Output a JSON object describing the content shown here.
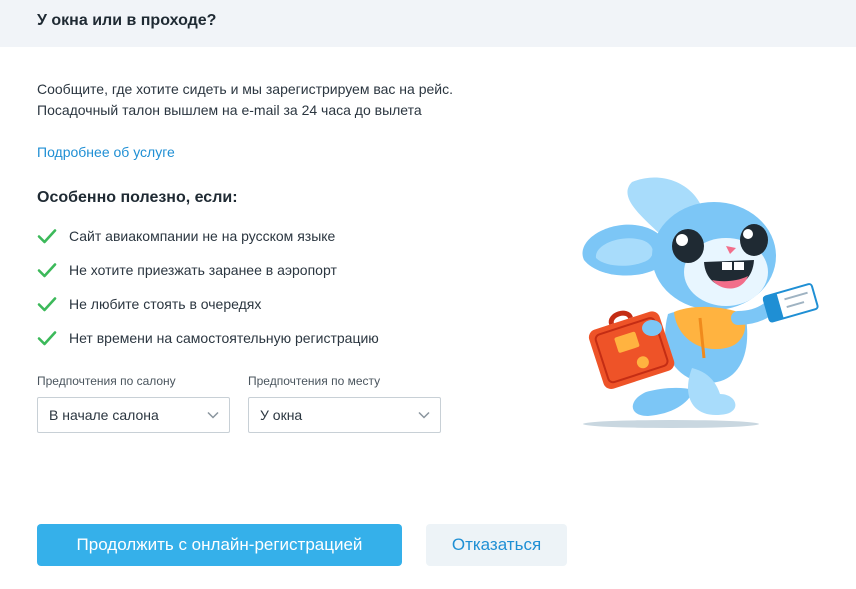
{
  "header": {
    "title": "У окна или в проходе?"
  },
  "description": {
    "line1": "Сообщите, где хотите сидеть и мы зарегистрируем вас на рейс.",
    "line2": "Посадочный талон вышлем на e-mail за 24 часа до вылета"
  },
  "more_link": "Подробнее об услуге",
  "benefits": {
    "title": "Особенно полезно, если:",
    "items": [
      "Сайт авиакомпании не на русском языке",
      "Не хотите приезжать заранее в аэропорт",
      "Не любите стоять в очередях",
      "Нет времени на самостоятельную регистрацию"
    ]
  },
  "preferences": {
    "cabin": {
      "label": "Предпочтения по салону",
      "value": "В начале салона"
    },
    "seat": {
      "label": "Предпочтения по месту",
      "value": "У окна"
    }
  },
  "actions": {
    "continue_label": "Продолжить с онлайн-регистрацией",
    "decline_label": "Отказаться"
  },
  "colors": {
    "accent": "#35b0ea",
    "link": "#1f8fd4",
    "check": "#3cb95a",
    "header_bg": "#f1f4f8"
  },
  "icons": [
    "check-icon",
    "chevron-down-icon",
    "mascot-rabbit-illustration"
  ]
}
